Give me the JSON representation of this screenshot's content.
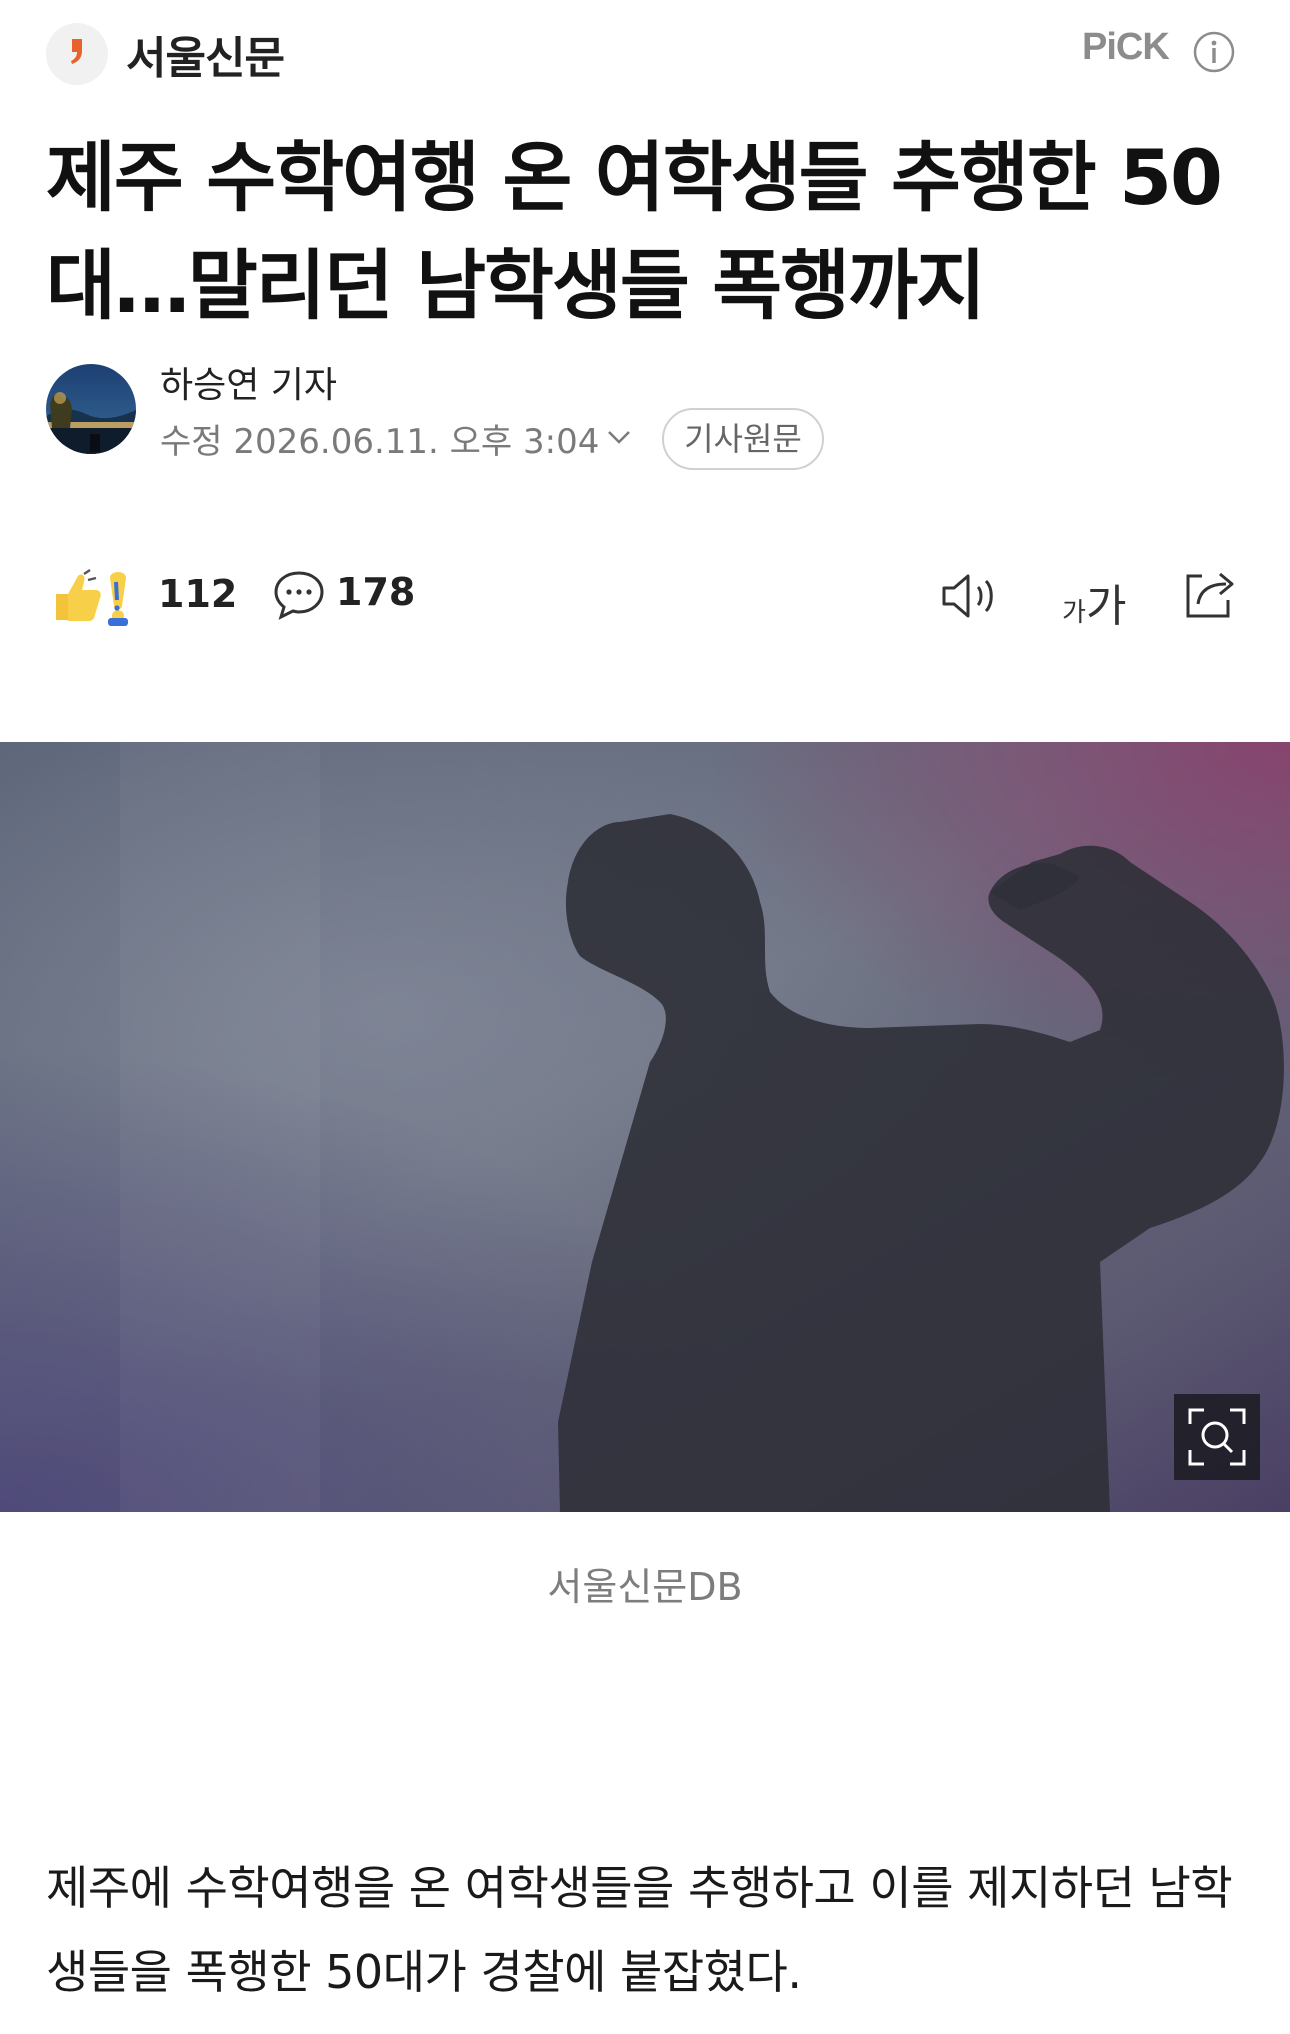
{
  "press": {
    "name": "서울신문",
    "pick_label": "PiCK",
    "logo_icon": "comma-logo",
    "info_icon": "info-icon"
  },
  "article": {
    "headline": "제주 수학여행 온 여학생들 추행한 50대…말리던 남학생들 폭행까지",
    "reporter": "하승연 기자",
    "modified": "수정 2026.06.11. 오후 3:04",
    "original_link": "기사원문",
    "photo_caption": "서울신문DB",
    "body": "제주에 수학여행을 온 여학생들을 추행하고 이를 제지하던 남학생들을 폭행한 50대가 경찰에 붙잡혔다."
  },
  "toolbar": {
    "reaction_count": "112",
    "comment_count": "178",
    "font_small": "가",
    "font_big": "가"
  },
  "colors": {
    "accent_orange": "#e8622c",
    "muted_text": "#7a7a7a"
  }
}
